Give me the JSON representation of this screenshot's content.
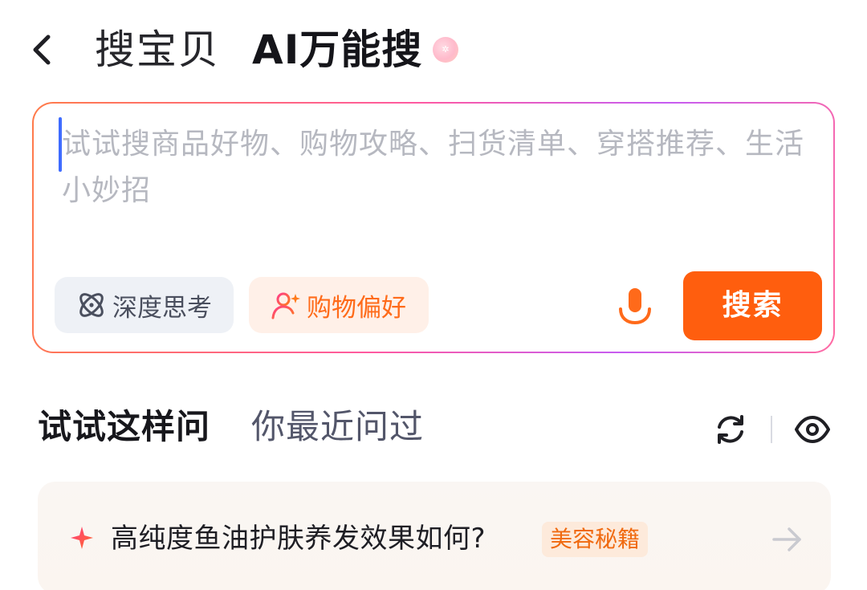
{
  "header": {
    "back_icon": "chevron-left-icon",
    "tab_search_item": "搜宝贝",
    "tab_ai_search": "AI万能搜",
    "ai_badge_icon": "ai-orb-icon"
  },
  "search": {
    "placeholder": "试试搜商品好物、购物攻略、扫货清单、穿搭推荐、生活小妙招",
    "chips": {
      "deep_think": "深度思考",
      "shopping_pref": "购物偏好"
    },
    "mic_icon": "microphone-icon",
    "search_button": "搜索",
    "colors": {
      "accent": "#ff5e0e",
      "border_gradient": [
        "#ff7b4a",
        "#ff5aa0",
        "#c65cf2"
      ]
    }
  },
  "section": {
    "tab_try": "试试这样问",
    "tab_recent": "你最近问过",
    "refresh_icon": "refresh-icon",
    "eye_icon": "eye-icon"
  },
  "suggestions": [
    {
      "text": "高纯度鱼油护肤养发效果如何?",
      "tag": "美容秘籍",
      "icon": "sparkle-icon",
      "arrow": "arrow-right-icon"
    }
  ]
}
